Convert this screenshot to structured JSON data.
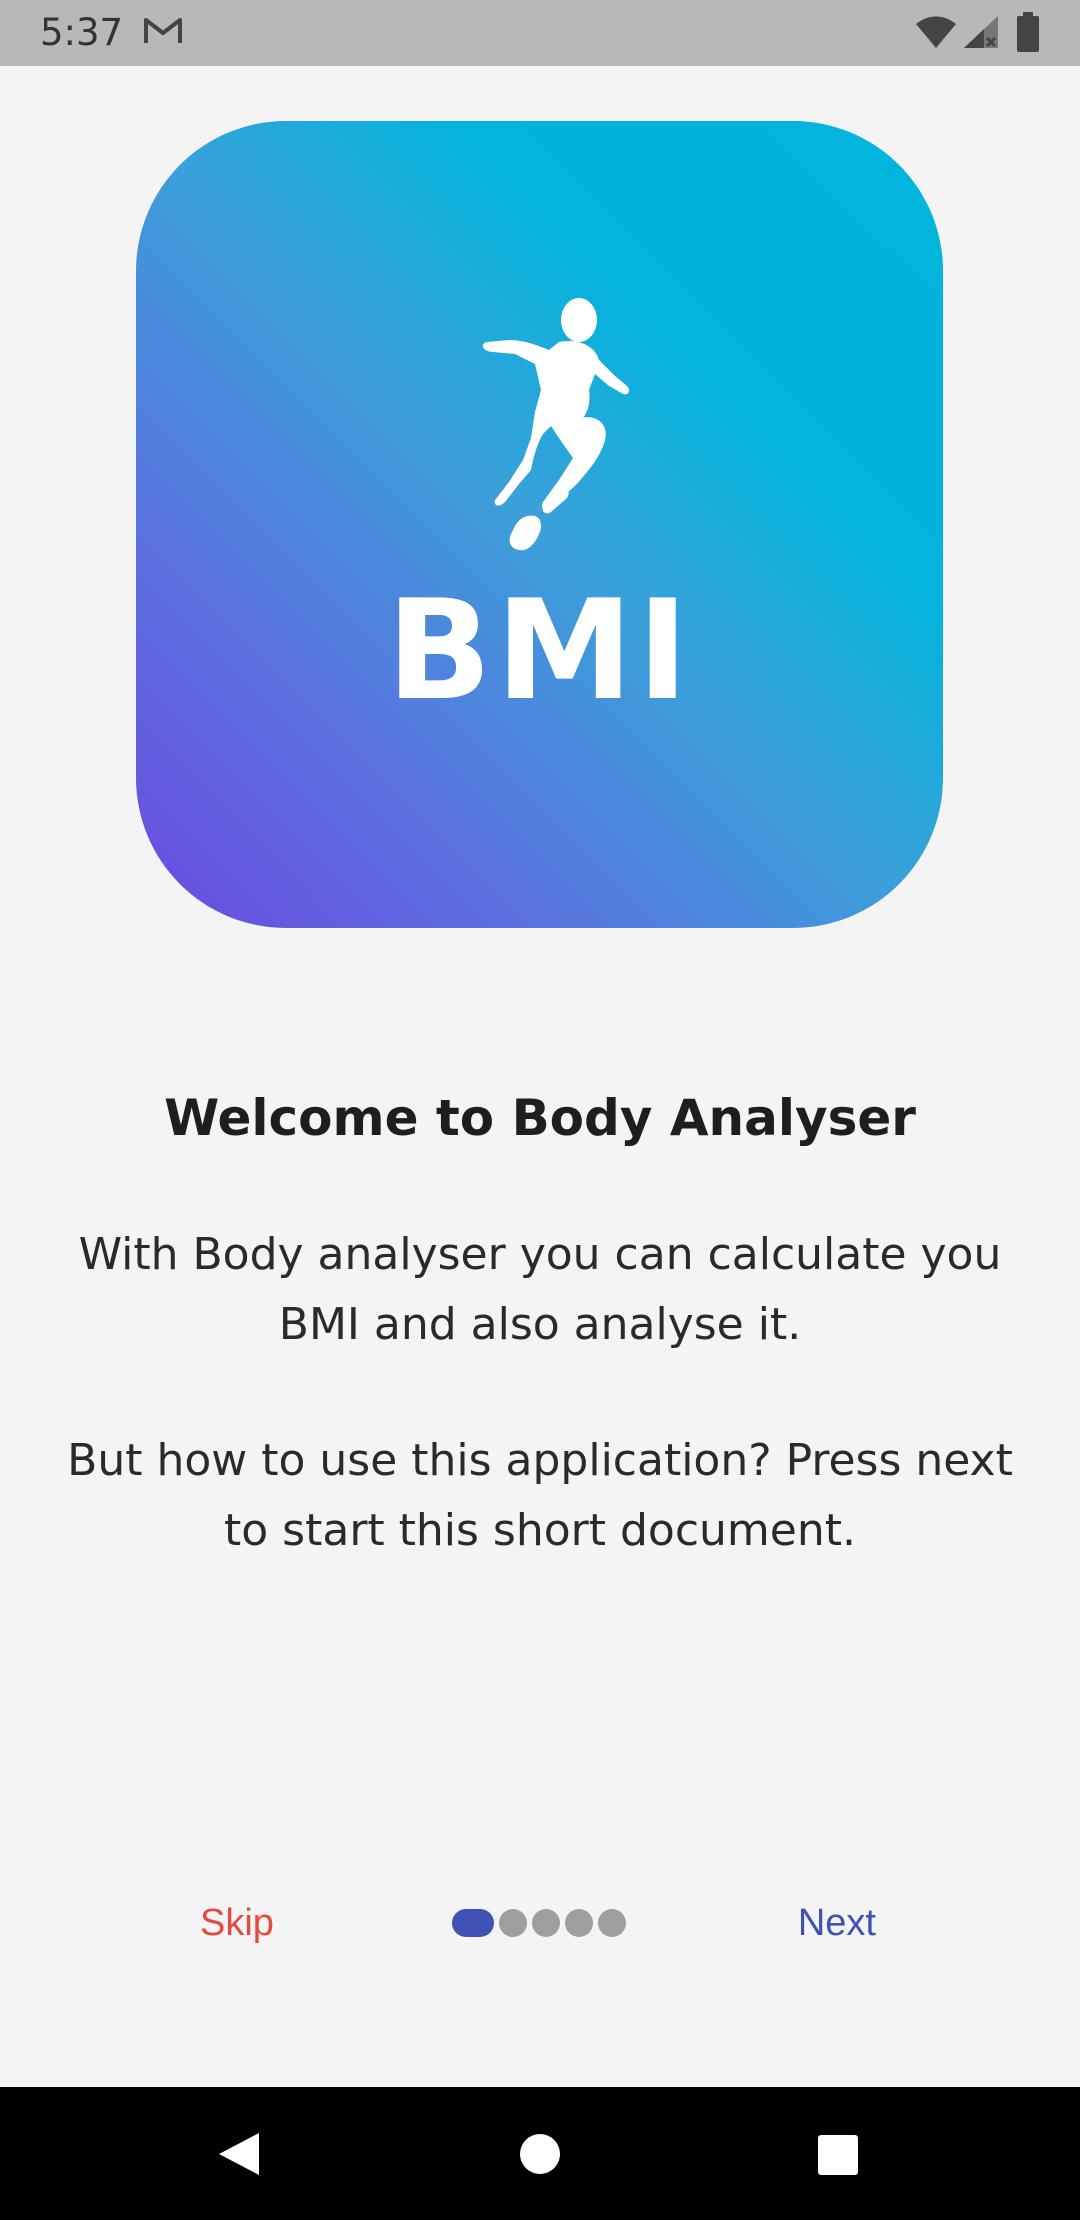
{
  "status_bar": {
    "time": "5:37",
    "notification_icon": "gmail-icon",
    "icons": [
      "wifi-icon",
      "cell-signal-icon",
      "battery-icon"
    ]
  },
  "logo": {
    "icon": "runner-icon",
    "text": "BMI"
  },
  "content": {
    "title": "Welcome to Body Analyser",
    "paragraph_1": "With Body analyser you can calculate you BMI and also analyse it.",
    "paragraph_2": "But how to use this application? Press next to start this short document."
  },
  "navigation": {
    "skip_label": "Skip",
    "next_label": "Next",
    "page_count": 5,
    "current_page": 1
  },
  "system_nav": {
    "icons": [
      "back-icon",
      "home-icon",
      "recents-icon"
    ]
  },
  "colors": {
    "skip": "#e64a3d",
    "next": "#3f51b5",
    "indicator_active": "#3f51b5",
    "indicator_inactive": "#9e9e9e",
    "gradient_start": "#6a4ae0",
    "gradient_end": "#00b5dd"
  }
}
